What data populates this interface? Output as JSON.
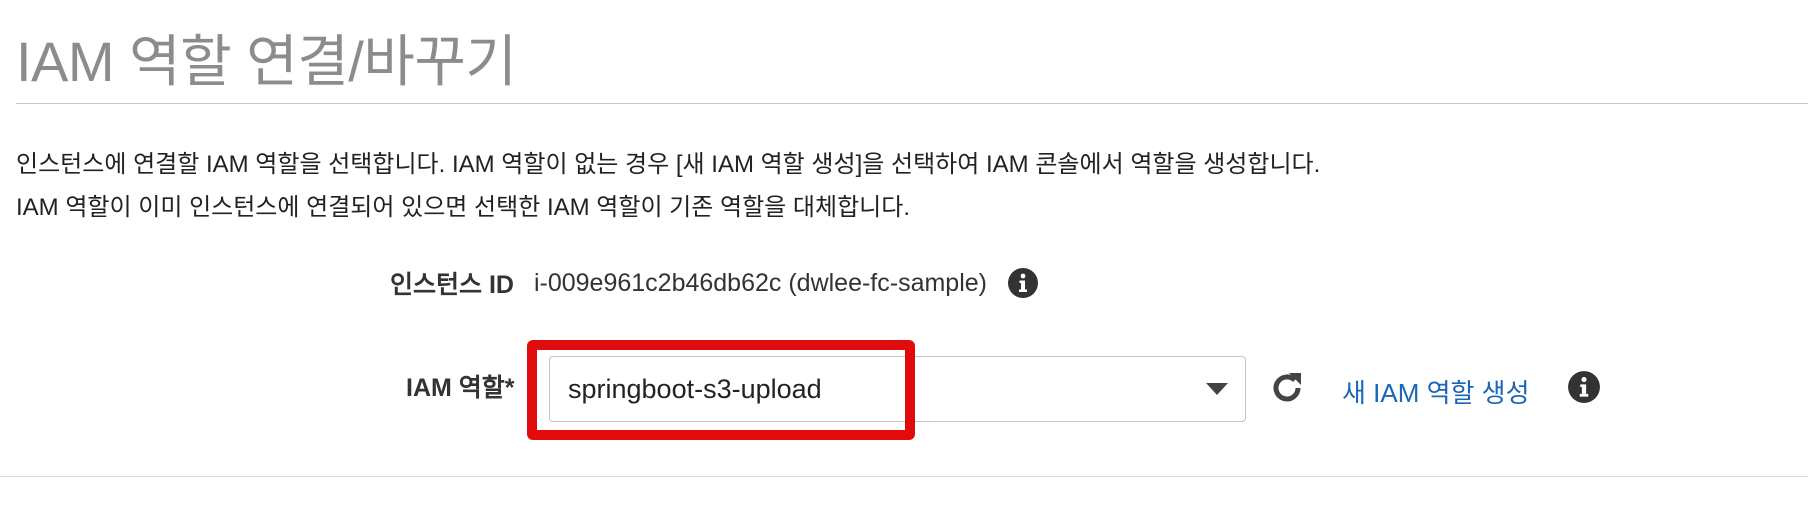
{
  "header": {
    "title": "IAM 역할 연결/바꾸기"
  },
  "description": {
    "line1": "인스턴스에 연결할 IAM 역할을 선택합니다. IAM 역할이 없는 경우 [새 IAM 역할 생성]을 선택하여 IAM 콘솔에서 역할을 생성합니다.",
    "line2": "IAM 역할이 이미 인스턴스에 연결되어 있으면 선택한 IAM 역할이 기존 역할을 대체합니다."
  },
  "instance": {
    "label": "인스턴스 ID",
    "value": "i-009e961c2b46db62c (dwlee-fc-sample)",
    "info_icon": "info-circle-icon"
  },
  "iam_role": {
    "label": "IAM 역할*",
    "selected_value": "springboot-s3-upload",
    "dropdown_icon": "caret-down-icon",
    "refresh_icon": "refresh-icon",
    "create_link": "새 IAM 역할 생성",
    "info_icon": "info-circle-icon"
  },
  "colors": {
    "title": "#8c8c8c",
    "link": "#1a66b8",
    "highlight": "#e10b0b",
    "icon": "#333333"
  }
}
